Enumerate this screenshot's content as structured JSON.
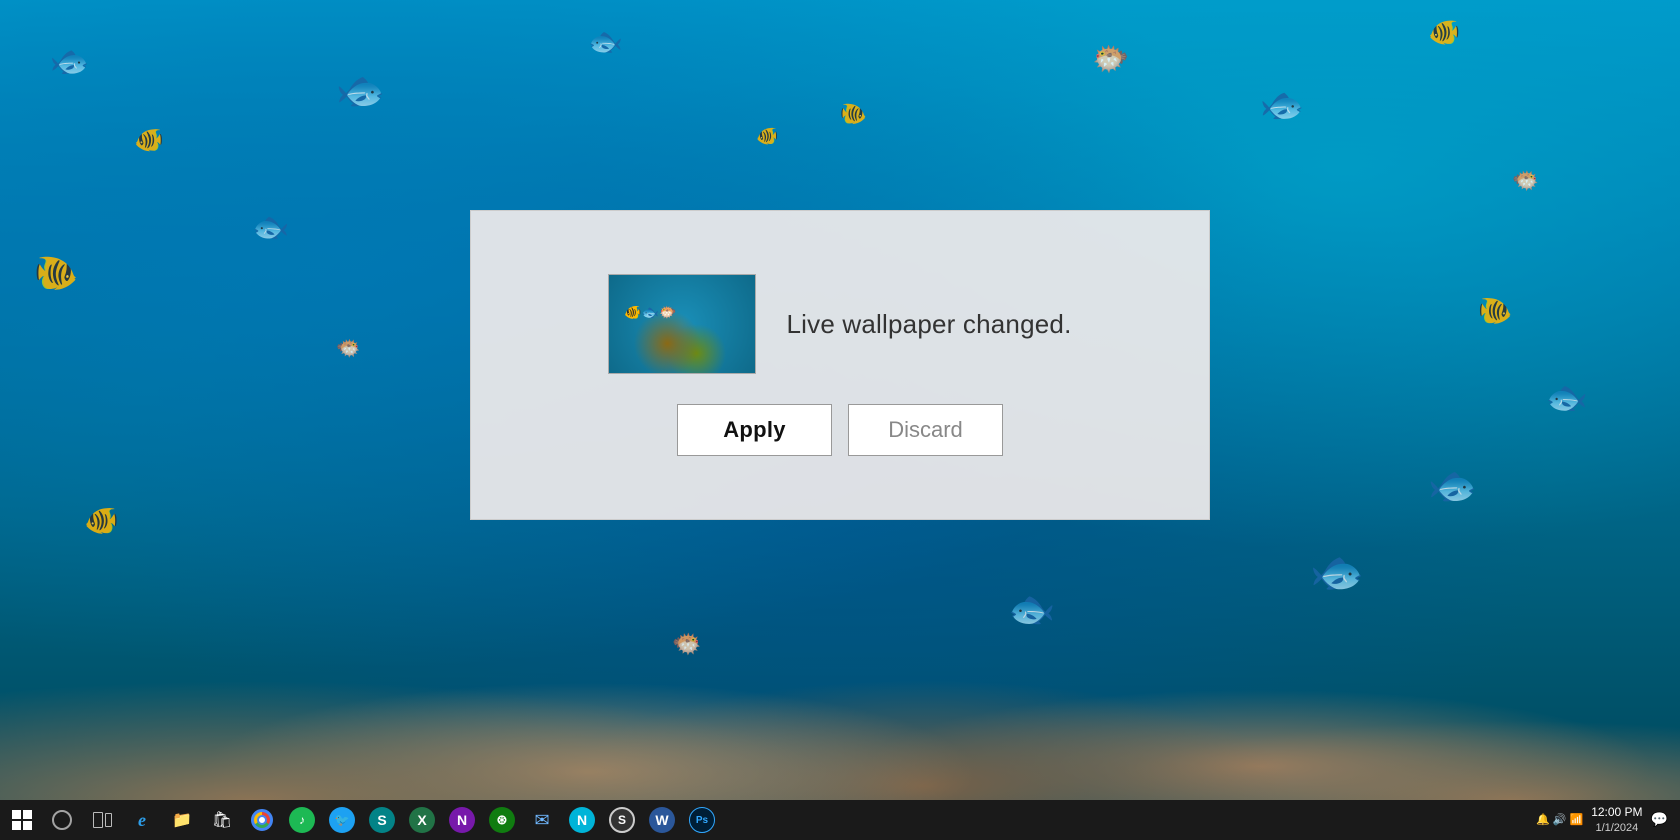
{
  "desktop": {
    "background_description": "Underwater coral reef with tropical fish"
  },
  "dialog": {
    "message": "Live wallpaper changed.",
    "apply_label": "Apply",
    "discard_label": "Discard",
    "thumbnail_alt": "Underwater fish wallpaper thumbnail"
  },
  "taskbar": {
    "icons": [
      {
        "name": "windows-start",
        "label": "Start",
        "symbol": "⊞"
      },
      {
        "name": "cortana",
        "label": "Search",
        "symbol": "○"
      },
      {
        "name": "task-view",
        "label": "Task View",
        "symbol": "❐"
      },
      {
        "name": "edge",
        "label": "Microsoft Edge",
        "symbol": "e",
        "color": "#2d9de8"
      },
      {
        "name": "file-explorer",
        "label": "File Explorer",
        "symbol": "📁",
        "color": "#ffc000"
      },
      {
        "name": "store",
        "label": "Microsoft Store",
        "symbol": "🛍"
      },
      {
        "name": "chrome",
        "label": "Google Chrome",
        "symbol": "◎",
        "color": "#4285f4"
      },
      {
        "name": "spotify",
        "label": "Spotify",
        "symbol": "♫",
        "color": "#1DB954"
      },
      {
        "name": "twitter",
        "label": "Twitter",
        "symbol": "🐦",
        "color": "#1DA1F2"
      },
      {
        "name": "sway",
        "label": "Microsoft Sway",
        "symbol": "S",
        "color": "#038387"
      },
      {
        "name": "excel",
        "label": "Microsoft Excel",
        "symbol": "X",
        "color": "#217346"
      },
      {
        "name": "onenote",
        "label": "OneNote",
        "symbol": "N",
        "color": "#7719aa"
      },
      {
        "name": "xbox",
        "label": "Xbox",
        "symbol": "⊛",
        "color": "#107c10"
      },
      {
        "name": "mail",
        "label": "Mail",
        "symbol": "✉",
        "color": "#0078d7"
      },
      {
        "name": "microsoft-edge-n",
        "label": "Edge N",
        "symbol": "N",
        "color": "#00b4d8"
      },
      {
        "name": "sonos",
        "label": "Sonos",
        "symbol": "S",
        "color": "#e8e8e8"
      },
      {
        "name": "word",
        "label": "Microsoft Word",
        "symbol": "W",
        "color": "#2b579a"
      },
      {
        "name": "photoshop",
        "label": "Photoshop",
        "symbol": "Ps",
        "color": "#31a8ff"
      }
    ],
    "time": "12:00 PM",
    "date": "1/1/2024"
  }
}
